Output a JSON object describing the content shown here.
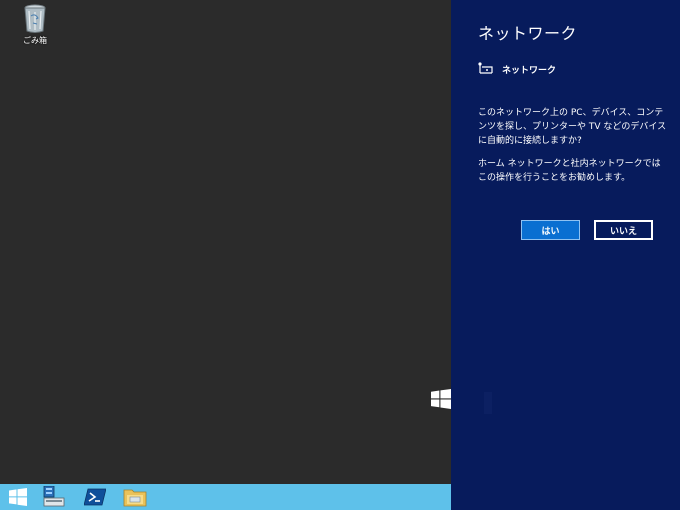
{
  "desktop": {
    "recycle_bin_label": "ごみ箱"
  },
  "taskbar": {
    "items": [
      "start-button",
      "server-manager",
      "powershell",
      "file-explorer"
    ],
    "color": "#5ec1ea"
  },
  "panel": {
    "title": "ネットワーク",
    "network_name": "ネットワーク",
    "question": "このネットワーク上の PC、デバイス、コンテンツを探し、プリンターや TV などのデバイスに自動的に接続しますか?",
    "recommendation": "ホーム ネットワークと社内ネットワークではこの操作を行うことをお勧めします。",
    "yes_label": "はい",
    "no_label": "いいえ",
    "background": "#071b5c",
    "accent": "#0a6fd1"
  }
}
